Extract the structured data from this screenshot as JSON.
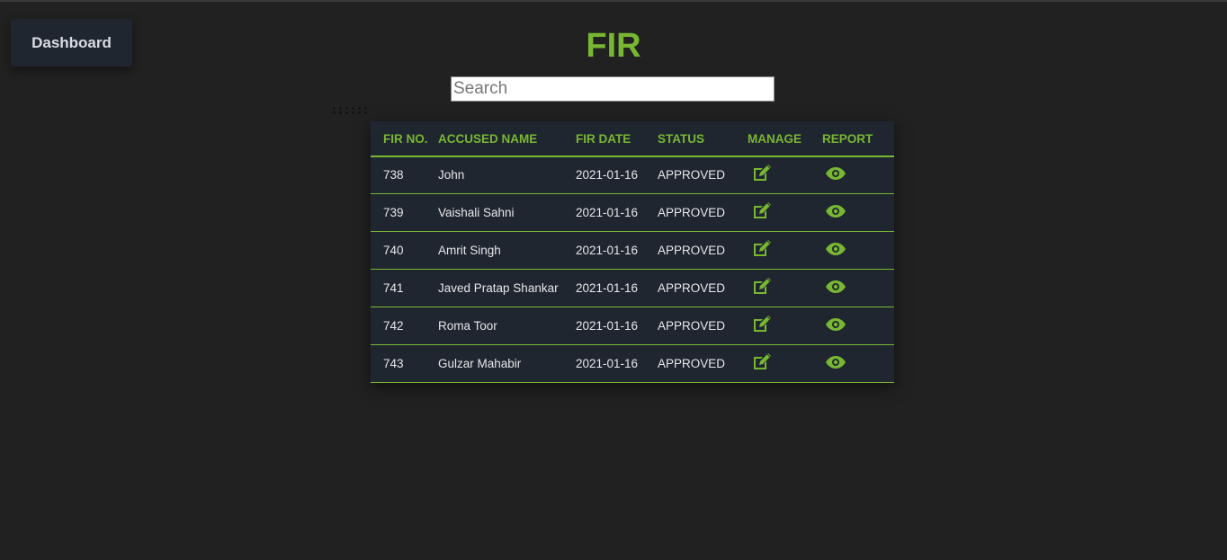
{
  "nav": {
    "dashboard_label": "Dashboard"
  },
  "page": {
    "title": "FIR"
  },
  "search": {
    "placeholder": "Search",
    "value": ""
  },
  "table": {
    "headers": [
      "FIR NO.",
      "ACCUSED NAME",
      "FIR DATE",
      "STATUS",
      "MANAGE",
      "REPORT"
    ],
    "rows": [
      {
        "fir_no": "738",
        "accused_name": "John",
        "fir_date": "2021-01-16",
        "status": "APPROVED"
      },
      {
        "fir_no": "739",
        "accused_name": "Vaishali Sahni",
        "fir_date": "2021-01-16",
        "status": "APPROVED"
      },
      {
        "fir_no": "740",
        "accused_name": "Amrit Singh",
        "fir_date": "2021-01-16",
        "status": "APPROVED"
      },
      {
        "fir_no": "741",
        "accused_name": "Javed Pratap Shankar",
        "fir_date": "2021-01-16",
        "status": "APPROVED"
      },
      {
        "fir_no": "742",
        "accused_name": "Roma Toor",
        "fir_date": "2021-01-16",
        "status": "APPROVED"
      },
      {
        "fir_no": "743",
        "accused_name": "Gulzar Mahabir",
        "fir_date": "2021-01-16",
        "status": "APPROVED"
      }
    ],
    "manage_icon": "edit-icon",
    "report_icon": "eye-icon"
  },
  "colors": {
    "background": "#212121",
    "panel": "#1f2630",
    "accent": "#78b732",
    "text": "#e7e7e7"
  }
}
